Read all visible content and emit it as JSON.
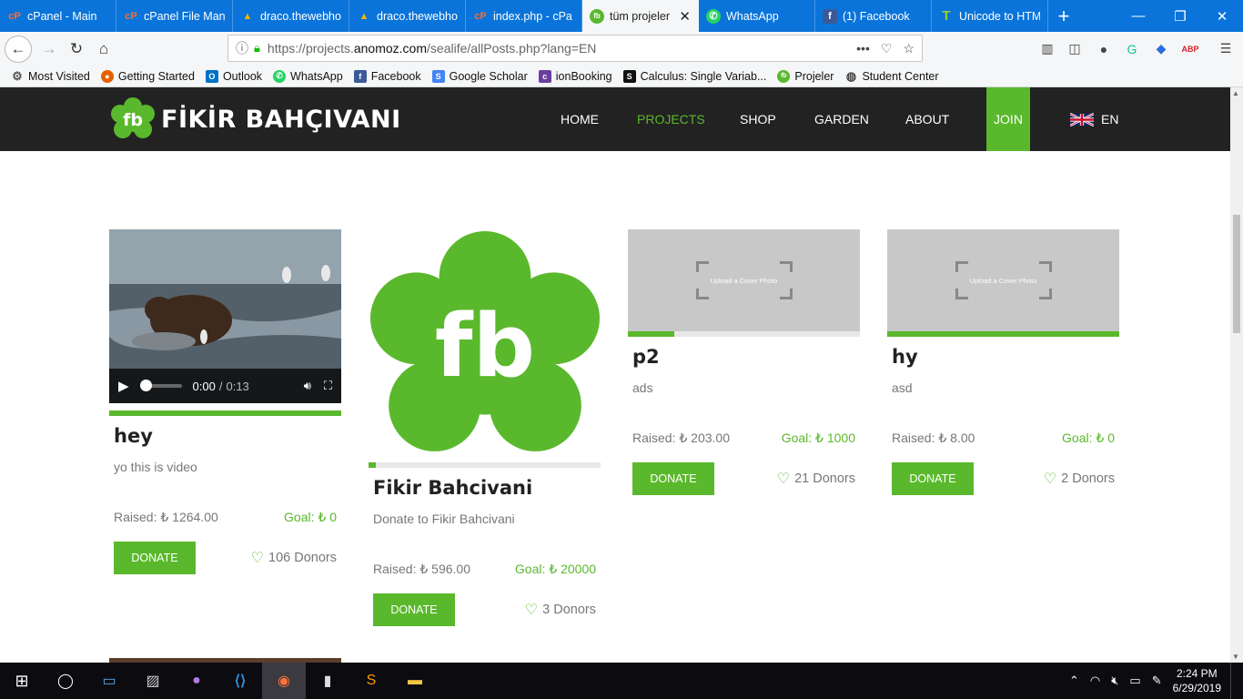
{
  "browser": {
    "tabs": [
      {
        "label": "cPanel - Main",
        "icon": "cpanel-icon",
        "active": false
      },
      {
        "label": "cPanel File Mana",
        "icon": "cpanel-icon",
        "active": false
      },
      {
        "label": "draco.thewebho",
        "icon": "webhost-icon",
        "active": false
      },
      {
        "label": "draco.thewebho",
        "icon": "webhost-icon",
        "active": false
      },
      {
        "label": "index.php - cPa",
        "icon": "cpanel-icon",
        "active": false
      },
      {
        "label": "tüm projeler",
        "icon": "fb-leaf-icon",
        "active": true
      },
      {
        "label": "WhatsApp",
        "icon": "whatsapp-icon",
        "active": false
      },
      {
        "label": "(1) Facebook",
        "icon": "facebook-icon",
        "active": false
      },
      {
        "label": "Unicode to HTM",
        "icon": "t-icon",
        "active": false
      }
    ],
    "url": {
      "prefix": "https://projects.",
      "domain": "anomoz.com",
      "path": "/sealife/allPosts.php?lang=EN"
    },
    "bookmarks": [
      {
        "label": "Most Visited",
        "icon": "gear-icon",
        "color": "#555555"
      },
      {
        "label": "Getting Started",
        "icon": "firefox-icon",
        "color": "#e66000"
      },
      {
        "label": "Outlook",
        "icon": "outlook-icon",
        "color": "#0072c6"
      },
      {
        "label": "WhatsApp",
        "icon": "whatsapp-icon",
        "color": "#25d366"
      },
      {
        "label": "Facebook",
        "icon": "facebook-icon",
        "color": "#3b5998"
      },
      {
        "label": "Google Scholar",
        "icon": "scholar-icon",
        "color": "#4285f4"
      },
      {
        "label": "ionBooking",
        "icon": "ion-icon",
        "color": "#6a3fa0"
      },
      {
        "label": "Calculus: Single Variab...",
        "icon": "s-icon",
        "color": "#111111"
      },
      {
        "label": "Projeler",
        "icon": "fb-leaf-icon",
        "color": "#5ab82c"
      },
      {
        "label": "Student Center",
        "icon": "globe-icon",
        "color": "#444444"
      }
    ]
  },
  "site": {
    "logo_text": "FİKİR BAHÇIVANI",
    "logo_mark": "fb",
    "menu": [
      "HOME",
      "PROJECTS",
      "SHOP",
      "GARDEN",
      "ABOUT"
    ],
    "active_menu": "PROJECTS",
    "join": "JOIN",
    "lang": "EN",
    "accent": "#5ab82c",
    "cover_placeholder": "Upload a Cover Photo",
    "raised_label": "Raised:",
    "goal_label": "Goal:",
    "donate_label": "DONATE",
    "donors_label": "Donors",
    "projects": [
      {
        "title": "hey",
        "desc": "yo this is video",
        "raised": "₺ 1264.00",
        "goal": "₺ 0",
        "donors": "106",
        "progress": 1.0,
        "media": "video"
      },
      {
        "title": "Fikir Bahcivani",
        "desc": "Donate to Fikir Bahcivani",
        "raised": "₺ 596.00",
        "goal": "₺ 20000",
        "donors": "3",
        "progress": 0.03,
        "media": "logo"
      },
      {
        "title": "p2",
        "desc": "ads",
        "raised": "₺ 203.00",
        "goal": "₺ 1000",
        "donors": "21",
        "progress": 0.2,
        "media": "placeholder"
      },
      {
        "title": "hy",
        "desc": "asd",
        "raised": "₺ 8.00",
        "goal": "₺ 0",
        "donors": "2",
        "progress": 1.0,
        "media": "placeholder"
      }
    ],
    "video": {
      "time": "0:00",
      "duration": "0:13"
    }
  },
  "taskbar": {
    "apps": [
      "windows-start-icon",
      "cortana-icon",
      "file-icon",
      "photos-icon",
      "github-icon",
      "vscode-icon",
      "firefox-icon",
      "terminal-icon",
      "sublime-icon",
      "explorer-icon"
    ],
    "time": "2:24 PM",
    "date": "6/29/2019"
  }
}
